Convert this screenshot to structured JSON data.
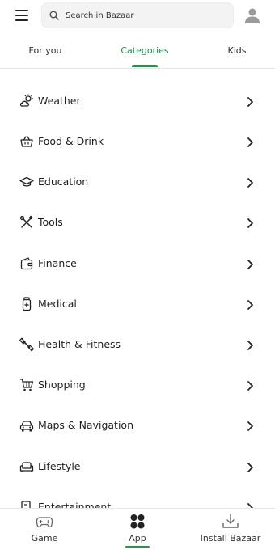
{
  "header": {
    "search_placeholder": "Search in Bazaar",
    "menu_icon": "hamburger-menu-icon",
    "avatar_icon": "user-avatar-icon"
  },
  "tabs": [
    {
      "label": "For you"
    },
    {
      "label": "Categories",
      "active": true
    },
    {
      "label": "Kids"
    }
  ],
  "categories": [
    {
      "label": "Weather",
      "icon": "weather-icon"
    },
    {
      "label": "Food & Drink",
      "icon": "food-basket-icon"
    },
    {
      "label": "Education",
      "icon": "graduation-cap-icon"
    },
    {
      "label": "Tools",
      "icon": "tools-icon"
    },
    {
      "label": "Finance",
      "icon": "wallet-icon"
    },
    {
      "label": "Medical",
      "icon": "medicine-bottle-icon"
    },
    {
      "label": "Health & Fitness",
      "icon": "dumbbell-icon"
    },
    {
      "label": "Shopping",
      "icon": "shopping-cart-icon"
    },
    {
      "label": "Maps & Navigation",
      "icon": "car-icon"
    },
    {
      "label": "Lifestyle",
      "icon": "sofa-icon"
    },
    {
      "label": "Entertainment",
      "icon": "entertainment-icon"
    }
  ],
  "bottom_nav": [
    {
      "label": "Game",
      "icon": "gamepad-icon"
    },
    {
      "label": "App",
      "icon": "apps-grid-icon",
      "active": true
    },
    {
      "label": "Install Bazaar",
      "icon": "download-icon"
    }
  ],
  "colors": {
    "accent": "#1e9a4e",
    "text": "#1f1f1f",
    "divider": "#e6e6e6"
  }
}
